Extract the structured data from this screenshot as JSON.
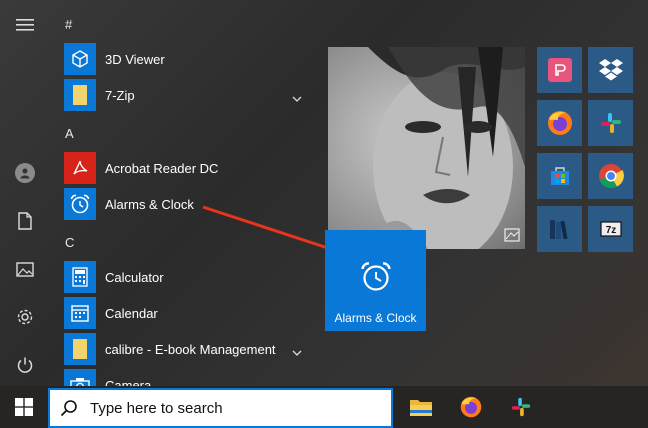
{
  "left_rail": {
    "items": [
      {
        "name": "hamburger-menu-icon"
      },
      {
        "name": "user-avatar"
      },
      {
        "name": "documents-icon"
      },
      {
        "name": "pictures-icon"
      },
      {
        "name": "settings-gear-icon"
      },
      {
        "name": "power-icon"
      }
    ]
  },
  "app_list": {
    "sections": {
      "hash": "#",
      "a": "A",
      "c": "C"
    },
    "apps": {
      "viewer3d": "3D Viewer",
      "zip": "7-Zip",
      "acrobat": "Acrobat Reader DC",
      "alarms": "Alarms & Clock",
      "calculator": "Calculator",
      "calendar": "Calendar",
      "calibre": "calibre - E-book Management",
      "camera": "Camera"
    }
  },
  "tiles": {
    "drag_tile_label": "Alarms & Clock",
    "items": [
      "photos",
      "parsec",
      "dropbox",
      "firefox",
      "slack",
      "store",
      "chrome",
      "books",
      "7zip"
    ]
  },
  "taskbar": {
    "search_placeholder": "Type here to search",
    "pinned": [
      "file-explorer",
      "firefox",
      "slack"
    ]
  },
  "colors": {
    "accent": "#0a78d7",
    "arrow": "#e8341c",
    "tile_bg": "#2c5a86"
  }
}
